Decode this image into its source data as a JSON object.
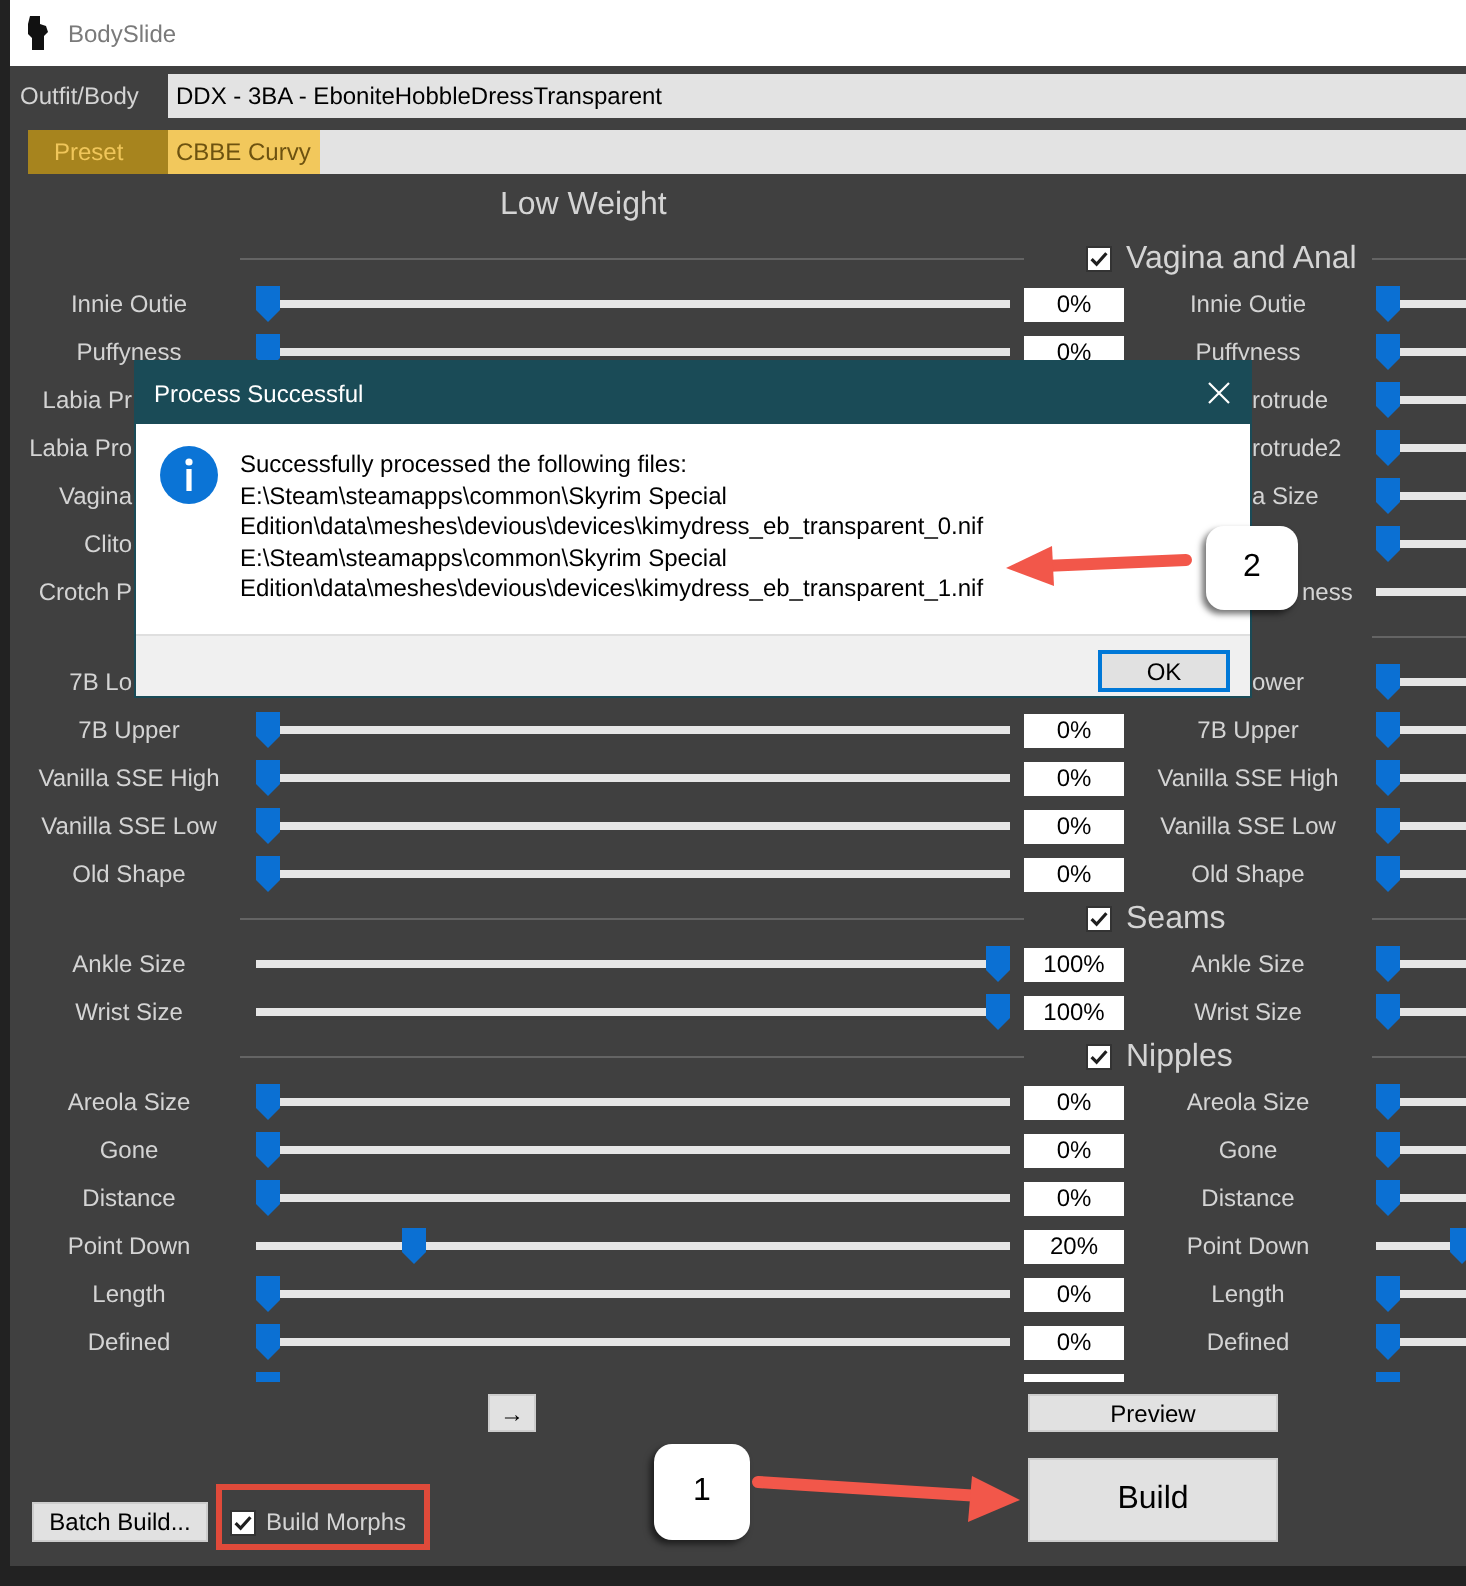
{
  "window": {
    "title": "BodySlide"
  },
  "outfit": {
    "label": "Outfit/Body",
    "value": "DDX - 3BA - EboniteHobbleDressTransparent"
  },
  "preset": {
    "label": "Preset",
    "value": "CBBE Curvy"
  },
  "heading": "Low Weight",
  "groups": [
    {
      "title": "Vagina and Anal",
      "checked": true,
      "sliders": [
        {
          "low": {
            "label": "Innie Outie",
            "level": 0,
            "reading": "0%"
          },
          "high": {
            "label": "Innie Outie",
            "level": 0
          }
        },
        {
          "low": {
            "label": "Puffyness",
            "level": 0,
            "reading": "0%"
          },
          "high": {
            "label": "Puffyness",
            "level": 0
          }
        },
        {
          "low": {
            "label": "Labia Pr",
            "under_dialog": true
          },
          "high": {
            "label": "rotrude",
            "under_dialog": true,
            "level": 0
          }
        },
        {
          "low": {
            "label": "Labia Pro",
            "under_dialog": true
          },
          "high": {
            "label": "rotrude2",
            "under_dialog": true,
            "level": 0
          }
        },
        {
          "low": {
            "label": "Vagina",
            "under_dialog": true
          },
          "high": {
            "label": "a Size",
            "under_dialog": true,
            "level": 0
          }
        },
        {
          "low": {
            "label": "Clito",
            "under_dialog": true
          },
          "high": {
            "level": 0
          }
        },
        {
          "low": {
            "label": "Crotch P",
            "under_dialog": true
          },
          "high": {
            "label": "ness",
            "under_callout": true
          }
        }
      ]
    },
    {
      "sliders": [
        {
          "low": {
            "label": "7B Lo",
            "under_dialog": true
          },
          "high": {
            "label": "ower",
            "under_dialog": true,
            "level": 0
          }
        },
        {
          "low": {
            "label": "7B Upper",
            "level": 0,
            "reading": "0%"
          },
          "high": {
            "label": "7B Upper",
            "level": 0
          }
        },
        {
          "low": {
            "label": "Vanilla SSE High",
            "level": 0,
            "reading": "0%"
          },
          "high": {
            "label": "Vanilla SSE High",
            "level": 0
          }
        },
        {
          "low": {
            "label": "Vanilla SSE Low",
            "level": 0,
            "reading": "0%"
          },
          "high": {
            "label": "Vanilla SSE Low",
            "level": 0
          }
        },
        {
          "low": {
            "label": "Old Shape",
            "level": 0,
            "reading": "0%"
          },
          "high": {
            "label": "Old Shape",
            "level": 0
          }
        }
      ]
    },
    {
      "title": "Seams",
      "checked": true,
      "sliders": [
        {
          "low": {
            "label": "Ankle Size",
            "level": 1,
            "reading": "100%"
          },
          "high": {
            "label": "Ankle Size",
            "level": 0
          }
        },
        {
          "low": {
            "label": "Wrist Size",
            "level": 1,
            "reading": "100%"
          },
          "high": {
            "label": "Wrist Size",
            "level": 0
          }
        }
      ]
    },
    {
      "title": "Nipples",
      "checked": true,
      "sliders": [
        {
          "low": {
            "label": "Areola Size",
            "level": 0,
            "reading": "0%"
          },
          "high": {
            "label": "Areola Size",
            "level": 0
          }
        },
        {
          "low": {
            "label": "Gone",
            "level": 0,
            "reading": "0%"
          },
          "high": {
            "label": "Gone",
            "level": 0
          }
        },
        {
          "low": {
            "label": "Distance",
            "level": 0,
            "reading": "0%"
          },
          "high": {
            "label": "Distance",
            "level": 0
          }
        },
        {
          "low": {
            "label": "Point Down",
            "level": 0.2,
            "reading": "20%"
          },
          "high": {
            "label": "Point Down",
            "level": 0.1
          }
        },
        {
          "low": {
            "label": "Length",
            "level": 0,
            "reading": "0%"
          },
          "high": {
            "label": "Length",
            "level": 0
          }
        },
        {
          "low": {
            "label": "Defined",
            "level": 0,
            "reading": "0%"
          },
          "high": {
            "label": "Defined",
            "level": 0
          }
        },
        {
          "low": {
            "level": 0
          },
          "high": {
            "level": 0
          }
        }
      ]
    }
  ],
  "bottom": {
    "arrow_button": "→",
    "batch_build_button": "Batch Build...",
    "build_morphs": {
      "label": "Build Morphs",
      "checked": true,
      "highlighted": true
    },
    "preview_button": "Preview",
    "build_button": "Build"
  },
  "dialog": {
    "title": "Process Successful",
    "message": "Successfully processed the following files:",
    "files": [
      "E:\\Steam\\steamapps\\common\\Skyrim Special Edition\\data\\meshes\\devious\\devices\\kimydress_eb_transparent_0.nif",
      "E:\\Steam\\steamapps\\common\\Skyrim Special Edition\\data\\meshes\\devious\\devices\\kimydress_eb_transparent_1.nif"
    ],
    "ok_button": "OK"
  },
  "callouts": [
    {
      "label": "1"
    },
    {
      "label": "2"
    }
  ]
}
